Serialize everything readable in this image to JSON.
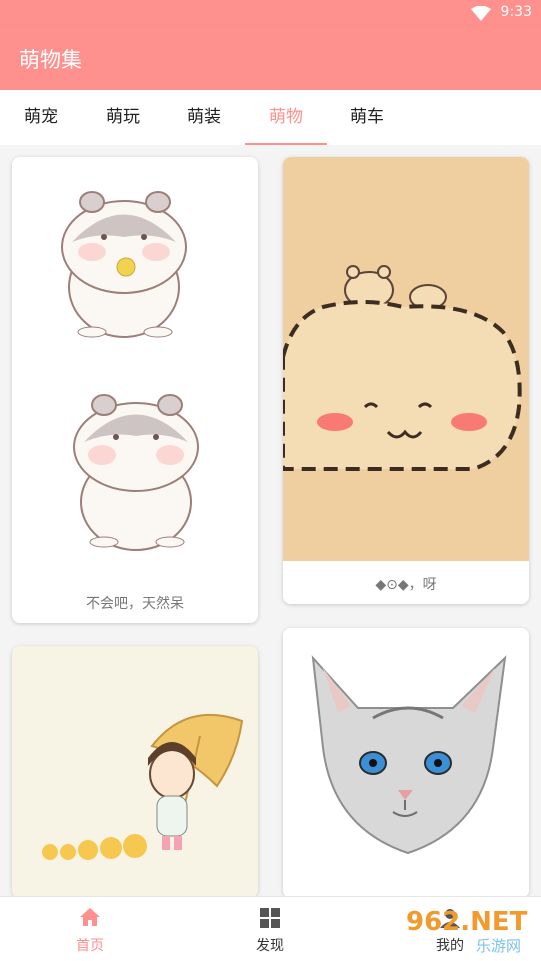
{
  "status": {
    "time": "9:33"
  },
  "appbar": {
    "title": "萌物集"
  },
  "tabs": [
    {
      "label": "萌宠",
      "active": false
    },
    {
      "label": "萌玩",
      "active": false
    },
    {
      "label": "萌装",
      "active": false
    },
    {
      "label": "萌物",
      "active": true
    },
    {
      "label": "萌车",
      "active": false
    }
  ],
  "cards": [
    {
      "caption": "不会吧，天然呆"
    },
    {
      "caption": "◆⊙◆，呀"
    },
    {
      "caption": ""
    },
    {
      "caption": ""
    }
  ],
  "bottom_nav": [
    {
      "label": "首页",
      "active": true
    },
    {
      "label": "发现",
      "active": false
    },
    {
      "label": "我的",
      "active": false
    }
  ],
  "watermark": {
    "brand": "962.NET",
    "sub": "乐游网"
  },
  "colors": {
    "accent": "#fe918d",
    "background": "#f4f4f4"
  }
}
